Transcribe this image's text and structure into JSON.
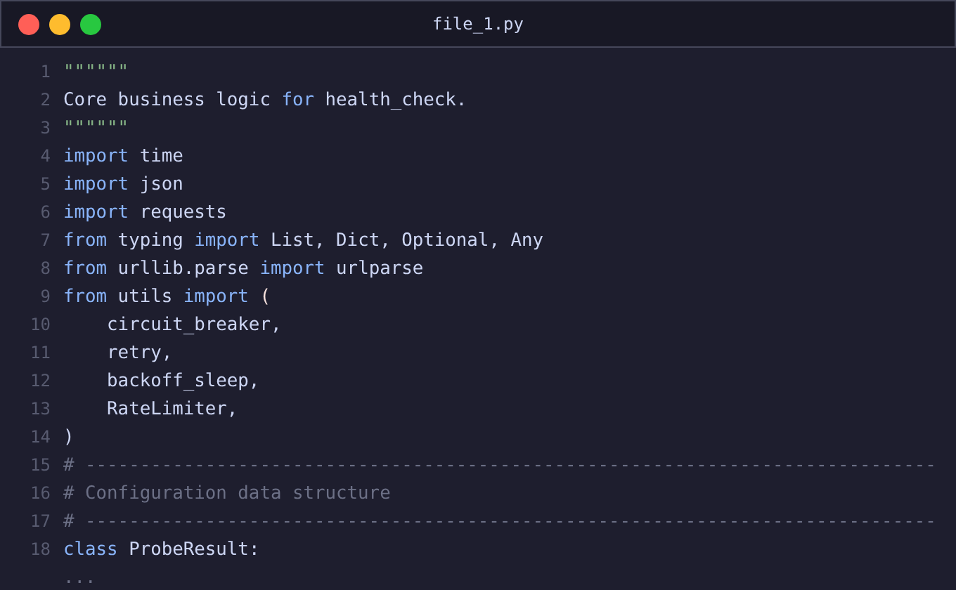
{
  "window": {
    "title": "file_1.py"
  },
  "lines": [
    {
      "number": "1",
      "tokens": [
        {
          "kind": "string",
          "text": "\"\"\"\"\"\""
        }
      ]
    },
    {
      "number": "2",
      "tokens": [
        {
          "kind": "plain",
          "text": "Core business logic "
        },
        {
          "kind": "keyword",
          "text": "for"
        },
        {
          "kind": "plain",
          "text": " health_check."
        }
      ]
    },
    {
      "number": "3",
      "tokens": [
        {
          "kind": "string",
          "text": "\"\"\"\"\"\""
        }
      ]
    },
    {
      "number": "4",
      "tokens": [
        {
          "kind": "keyword",
          "text": "import"
        },
        {
          "kind": "plain",
          "text": " time"
        }
      ]
    },
    {
      "number": "5",
      "tokens": [
        {
          "kind": "keyword",
          "text": "import"
        },
        {
          "kind": "plain",
          "text": " json"
        }
      ]
    },
    {
      "number": "6",
      "tokens": [
        {
          "kind": "keyword",
          "text": "import"
        },
        {
          "kind": "plain",
          "text": " requests"
        }
      ]
    },
    {
      "number": "7",
      "tokens": [
        {
          "kind": "keyword",
          "text": "from"
        },
        {
          "kind": "plain",
          "text": " typing "
        },
        {
          "kind": "keyword",
          "text": "import"
        },
        {
          "kind": "plain",
          "text": " List, Dict, Optional, Any"
        }
      ]
    },
    {
      "number": "8",
      "tokens": [
        {
          "kind": "keyword",
          "text": "from"
        },
        {
          "kind": "plain",
          "text": " urllib.parse "
        },
        {
          "kind": "keyword",
          "text": "import"
        },
        {
          "kind": "plain",
          "text": " urlparse"
        }
      ]
    },
    {
      "number": "9",
      "tokens": [
        {
          "kind": "keyword",
          "text": "from"
        },
        {
          "kind": "plain",
          "text": " utils "
        },
        {
          "kind": "keyword",
          "text": "import"
        },
        {
          "kind": "punct",
          "text": " ("
        }
      ]
    },
    {
      "number": "10",
      "tokens": [
        {
          "kind": "plain",
          "text": "    circuit_breaker,"
        }
      ]
    },
    {
      "number": "11",
      "tokens": [
        {
          "kind": "plain",
          "text": "    retry,"
        }
      ]
    },
    {
      "number": "12",
      "tokens": [
        {
          "kind": "plain",
          "text": "    backoff_sleep,"
        }
      ]
    },
    {
      "number": "13",
      "tokens": [
        {
          "kind": "plain",
          "text": "    RateLimiter,"
        }
      ]
    },
    {
      "number": "14",
      "tokens": [
        {
          "kind": "plain",
          "text": ")"
        }
      ]
    },
    {
      "number": "15",
      "tokens": [
        {
          "kind": "comment",
          "text": "# ------------------------------------------------------------------------------"
        }
      ]
    },
    {
      "number": "16",
      "tokens": [
        {
          "kind": "comment",
          "text": "# Configuration data structure"
        }
      ]
    },
    {
      "number": "17",
      "tokens": [
        {
          "kind": "comment",
          "text": "# ------------------------------------------------------------------------------"
        }
      ]
    },
    {
      "number": "18",
      "tokens": [
        {
          "kind": "keyword",
          "text": "class"
        },
        {
          "kind": "plain",
          "text": " ProbeResult:"
        }
      ]
    },
    {
      "tokens": [
        {
          "kind": "comment",
          "text": "..."
        }
      ]
    }
  ]
}
